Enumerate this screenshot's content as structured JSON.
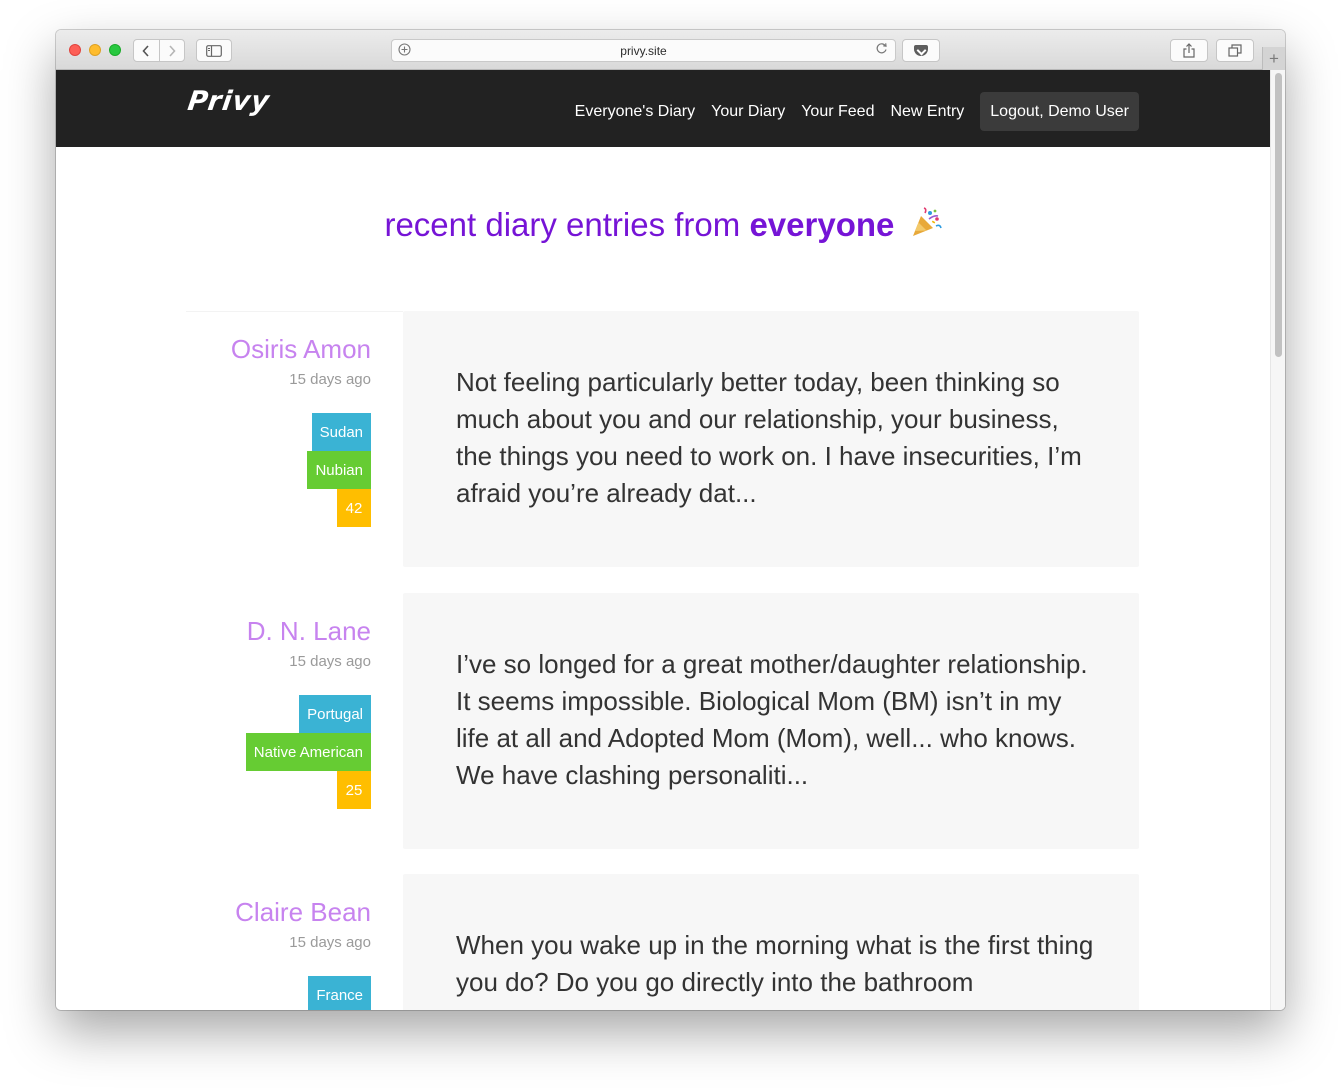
{
  "browser": {
    "url": "privy.site"
  },
  "site": {
    "logo": "Privy",
    "nav": {
      "everyones_diary": "Everyone's Diary",
      "your_diary": "Your Diary",
      "your_feed": "Your Feed",
      "new_entry": "New Entry",
      "logout": "Logout, Demo User"
    }
  },
  "heading": {
    "prefix": "recent diary entries from",
    "emphasis": "everyone",
    "icon": "party-popper-icon"
  },
  "entries": [
    {
      "author": "Osiris Amon",
      "time": "15 days ago",
      "country": "Sudan",
      "ethnicity": "Nubian",
      "age": "42",
      "excerpt": "Not feeling particularly better today, been thinking so much about you and our relationship, your business, the things you need to work on. I have insecurities, I’m afraid you’re already dat..."
    },
    {
      "author": "D. N. Lane",
      "time": "15 days ago",
      "country": "Portugal",
      "ethnicity": "Native American",
      "age": "25",
      "excerpt": "I’ve so longed for a great mother/daughter relationship. It seems impossible. Biological Mom (BM) isn’t in my life at all and Adopted Mom (Mom), well... who knows. We have clashing personaliti..."
    },
    {
      "author": "Claire Bean",
      "time": "15 days ago",
      "country": "France",
      "excerpt": "When you wake up in the morning what is the first thing you do? Do you go directly into the bathroom"
    }
  ],
  "colors": {
    "accent": "#7614d6",
    "author": "#c783ef",
    "tag_country": "#3ab3d4",
    "tag_ethnicity": "#66cc33",
    "tag_age": "#ffbe00",
    "navbar": "#222222"
  }
}
